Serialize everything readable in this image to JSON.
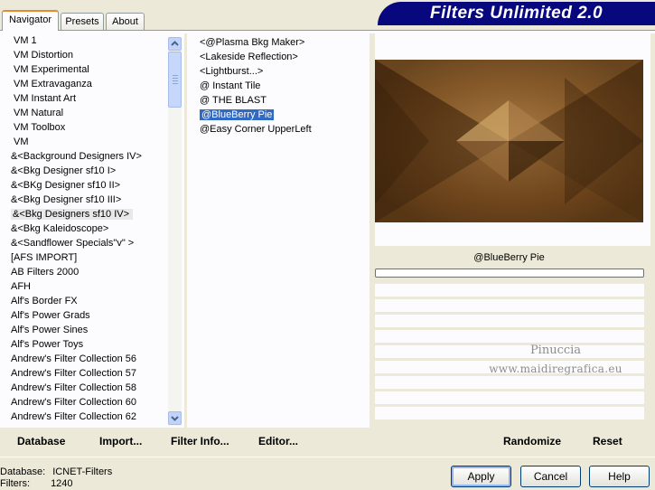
{
  "tabs": [
    {
      "label": "Navigator",
      "active": true
    },
    {
      "label": "Presets",
      "active": false
    },
    {
      "label": "About",
      "active": false
    }
  ],
  "title": "Filters Unlimited 2.0",
  "categories": [
    "VM 1",
    "VM Distortion",
    "VM Experimental",
    "VM Extravaganza",
    "VM Instant Art",
    "VM Natural",
    "VM Toolbox",
    "VM",
    "&<Background Designers IV>",
    "&<Bkg Designer sf10 I>",
    "&<BKg Designer sf10 II>",
    "&<Bkg Designer sf10 III>",
    "&<Bkg Designers sf10 IV>",
    "&<Bkg Kaleidoscope>",
    "&<Sandflower Specials\"v\" >",
    "[AFS IMPORT]",
    "AB Filters 2000",
    "AFH",
    "Alf's Border FX",
    "Alf's Power Grads",
    "Alf's Power Sines",
    "Alf's Power Toys",
    "Andrew's Filter Collection 56",
    "Andrew's Filter Collection 57",
    "Andrew's Filter Collection 58",
    "Andrew's Filter Collection 60",
    "Andrew's Filter Collection 62"
  ],
  "selected_category": "&<Bkg Designers sf10 IV>",
  "filters": [
    "<@Plasma Bkg Maker>",
    "<Lakeside Reflection>",
    "<Lightburst...>",
    "@ Instant Tile",
    "@ THE BLAST",
    "@BlueBerry Pie",
    "@Easy Corner UpperLeft"
  ],
  "selected_filter": "@BlueBerry Pie",
  "preview": {
    "filter_name": "@BlueBerry Pie",
    "progress": 0
  },
  "watermark": {
    "line1": "Pinuccia",
    "line2": "www.maidiregrafica.eu"
  },
  "links": {
    "database": "Database",
    "import": "Import...",
    "filter_info": "Filter Info...",
    "editor": "Editor...",
    "randomize": "Randomize",
    "reset": "Reset"
  },
  "buttons": {
    "apply": "Apply",
    "cancel": "Cancel",
    "help": "Help"
  },
  "status": {
    "database_label": "Database:",
    "database_value": "ICNET-Filters",
    "filters_label": "Filters:",
    "filters_value": "1240"
  },
  "colors": {
    "banner": "#08087e",
    "selection": "#316ac5",
    "accent": "#e68b2c"
  }
}
